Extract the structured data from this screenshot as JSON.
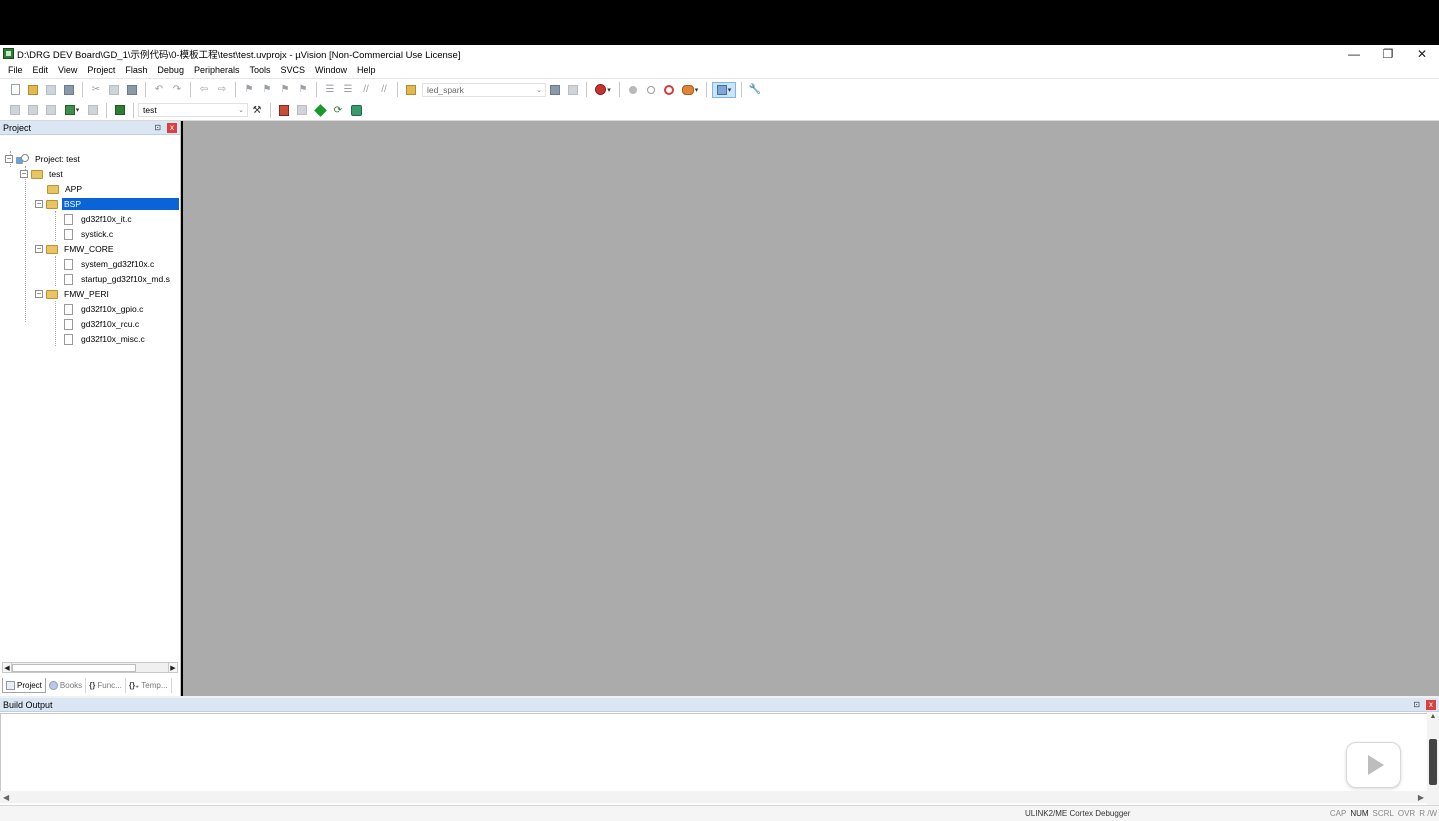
{
  "window": {
    "title": "D:\\DRG DEV Board\\GD_1\\示例代码\\0-模板工程\\test\\test.uvprojx - µVision  [Non-Commercial Use License]",
    "controls": {
      "minimize": "—",
      "restore": "❐",
      "close": "✕"
    }
  },
  "menu": {
    "items": [
      "File",
      "Edit",
      "View",
      "Project",
      "Flash",
      "Debug",
      "Peripherals",
      "Tools",
      "SVCS",
      "Window",
      "Help"
    ]
  },
  "toolbar1": {
    "config_combo_value": "led_spark",
    "combo_arrow": "⌄"
  },
  "toolbar2": {
    "target_combo_value": "test",
    "combo_arrow": "⌄"
  },
  "project_panel": {
    "title": "Project",
    "pin_symbol": "⊡",
    "close_symbol": "x",
    "tree": {
      "root": "Project: test",
      "target": "test",
      "groups": [
        {
          "name": "APP",
          "files": []
        },
        {
          "name": "BSP",
          "files": [
            "gd32f10x_it.c",
            "systick.c"
          ]
        },
        {
          "name": "FMW_CORE",
          "files": [
            "system_gd32f10x.c",
            "startup_gd32f10x_md.s"
          ]
        },
        {
          "name": "FMW_PERI",
          "files": [
            "gd32f10x_gpio.c",
            "gd32f10x_rcu.c",
            "gd32f10x_misc.c"
          ]
        }
      ],
      "selected": "BSP",
      "collapse_symbol": "−"
    },
    "scroll": {
      "left": "◀",
      "right": "▶"
    },
    "tabs": [
      {
        "label": "Project",
        "icon": "project-tab-icon"
      },
      {
        "label": "Books",
        "icon": "books-tab-icon"
      },
      {
        "label": "Func...",
        "icon": "functions-tab-icon",
        "glyph": "{}"
      },
      {
        "label": "Temp...",
        "icon": "templates-tab-icon",
        "glyph": "{}₊"
      }
    ]
  },
  "build_output": {
    "title": "Build Output",
    "pin_symbol": "⊡",
    "close_symbol": "x",
    "scroll_up": "▲",
    "scroll_left": "◀",
    "scroll_right": "▶"
  },
  "status_bar": {
    "debugger": "ULINK2/ME Cortex Debugger",
    "keys": [
      "CAP",
      "NUM",
      "SCRL",
      "OVR",
      "R /W"
    ]
  },
  "colors": {
    "editor_background": "#ababab",
    "selection": "#0a64d8",
    "panel_header": "#dbe6f4"
  }
}
